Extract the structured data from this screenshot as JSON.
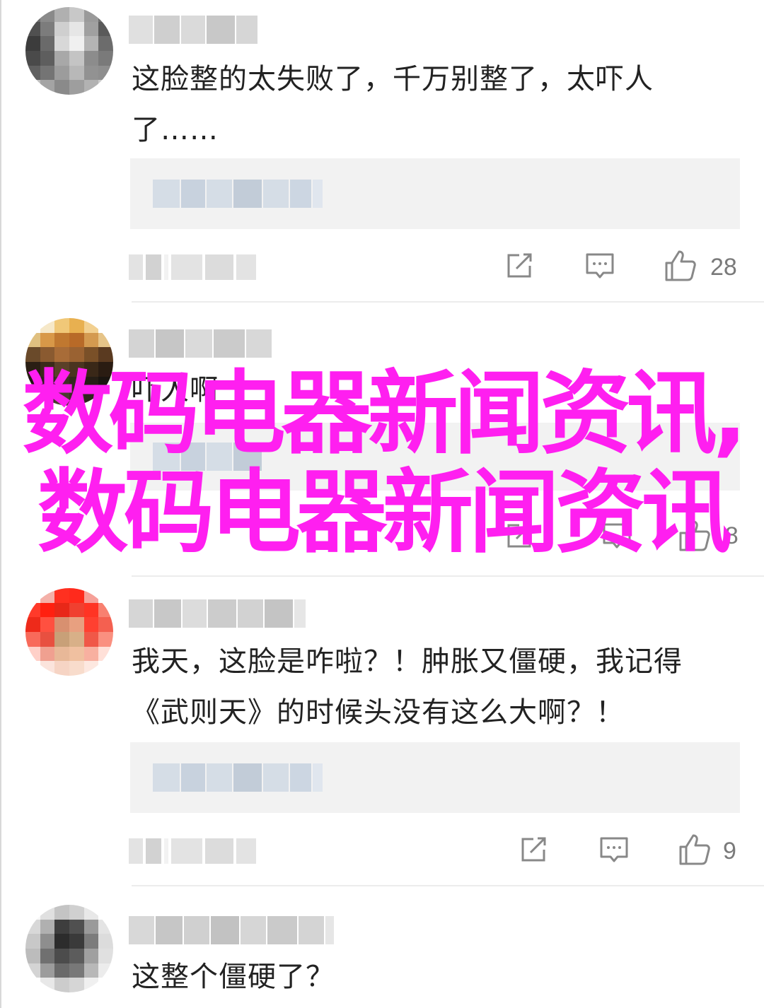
{
  "comments": [
    {
      "text_line1": "这脸整的太失败了，千万别整了，太吓人",
      "text_line2": "了……",
      "likes": "28",
      "avatar_colors": [
        "#6e6e6e",
        "#8a8a8a",
        "#b0b0b0",
        "#c8c8c8",
        "#9a9a9a",
        "#707070",
        "#505050",
        "#7c7c7c",
        "#cfcfcf",
        "#e6e6e6",
        "#a0a0a0",
        "#5a5a5a",
        "#3c3c3c",
        "#6a6a6a",
        "#d8d8d8",
        "#f0f0f0",
        "#b4b4b4",
        "#6c6c6c",
        "#4a4a4a",
        "#5e5e5e",
        "#a8a8a8",
        "#c4c4c4",
        "#8c8c8c",
        "#7a7a7a",
        "#606060",
        "#747474",
        "#9c9c9c",
        "#b8b8b8",
        "#929292",
        "#8e8e8e",
        "#c0c0c0",
        "#a4a4a4",
        "#8a8a8a",
        "#9e9e9e",
        "#b2b2b2",
        "#cccccc"
      ]
    },
    {
      "text_line1": "吓人啊",
      "likes": "18",
      "avatar_colors": [
        "#ffffff",
        "#f6e8c8",
        "#f0c878",
        "#e8b050",
        "#f2d090",
        "#ffffff",
        "#e0c080",
        "#d89848",
        "#c07830",
        "#b86a28",
        "#d49a50",
        "#e6c488",
        "#6a4a2a",
        "#8a5a30",
        "#a86c38",
        "#9a6232",
        "#7a5028",
        "#5a3a20",
        "#2a1e14",
        "#3a2a1a",
        "#5a4028",
        "#4a3420",
        "#3a2818",
        "#2a1c12",
        "#1e1812",
        "#2c241c",
        "#3e3226",
        "#34291e",
        "#261e16",
        "#1a1510",
        "#ffffff",
        "#3a3026",
        "#4a3c2e",
        "#3c3024",
        "#2e261c",
        "#ffffff"
      ]
    },
    {
      "text_line1": "我天，这脸是咋啦？！肿胀又僵硬，我记得",
      "text_line2": "《武则天》的时候头没有这么大啊？！",
      "likes": "9",
      "avatar_colors": [
        "#ffffff",
        "#f4b0a8",
        "#ff3020",
        "#ff2a1c",
        "#f6a098",
        "#ffffff",
        "#ff3a2a",
        "#ff2010",
        "#e82818",
        "#f04030",
        "#ff3424",
        "#f88070",
        "#ee2a1a",
        "#ff5040",
        "#d89070",
        "#e8a080",
        "#ff4030",
        "#f46050",
        "#f86a5a",
        "#e85040",
        "#c8a078",
        "#d8b088",
        "#f05848",
        "#fa9080",
        "#ffd0c8",
        "#f0a090",
        "#e8b898",
        "#f0c0a0",
        "#f8b0a0",
        "#ffe0d8",
        "#ffffff",
        "#fbe4dc",
        "#f6d4c4",
        "#f8dccc",
        "#fde8e0",
        "#ffffff"
      ]
    },
    {
      "text_line1": "这整个僵硬了？",
      "avatar_colors": [
        "#f8f8f8",
        "#e0e0e0",
        "#c4c4c4",
        "#d0d0d0",
        "#e8e8e8",
        "#ffffff",
        "#d8d8d8",
        "#b0b0b0",
        "#3e3e3e",
        "#505050",
        "#9a9a9a",
        "#e4e4e4",
        "#c8c8c8",
        "#8e8e8e",
        "#2c2c2c",
        "#3a3a3a",
        "#7c7c7c",
        "#dcdcdc",
        "#bcbcbc",
        "#707070",
        "#4c4c4c",
        "#5c5c5c",
        "#a0a0a0",
        "#e0e0e0",
        "#d4d4d4",
        "#9c9c9c",
        "#6a6a6a",
        "#787878",
        "#b8b8b8",
        "#ececec",
        "#ffffff",
        "#e8e8e8",
        "#cccccc",
        "#d6d6d6",
        "#f0f0f0",
        "#ffffff"
      ]
    }
  ],
  "watermark": {
    "text": "数码电器新闻资讯,数码电器新闻资讯",
    "color": "#ff1ff0"
  },
  "icons": {
    "share": "share-icon",
    "reply": "comment-icon",
    "like": "thumbs-up-icon"
  }
}
